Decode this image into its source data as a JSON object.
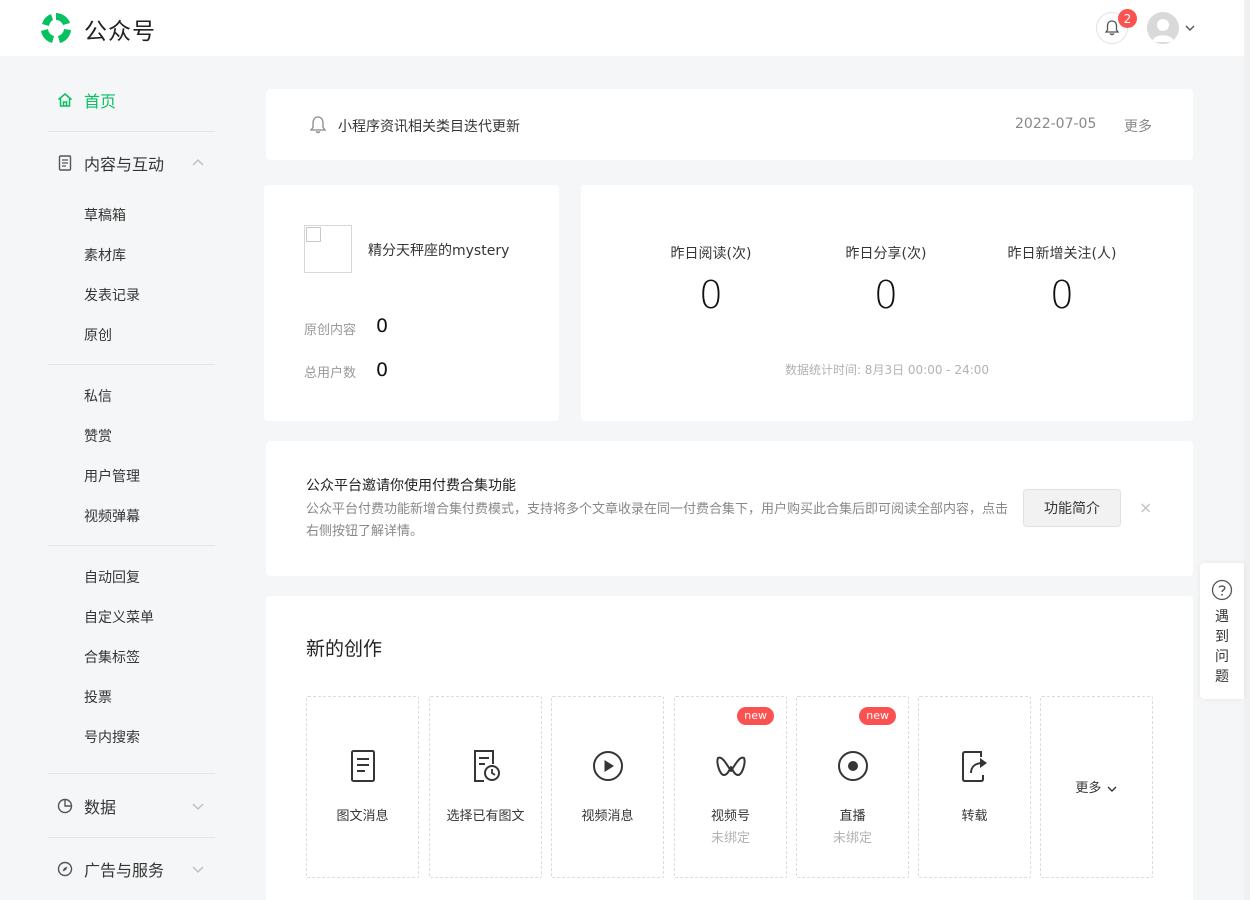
{
  "header": {
    "brand": "公众号",
    "notification_count": "2",
    "colors": {
      "brand": "#07c160",
      "badge": "#fa5151"
    }
  },
  "sidebar": {
    "home": "首页",
    "content_section": "内容与互动",
    "content_items": [
      "草稿箱",
      "素材库",
      "发表记录",
      "原创"
    ],
    "interaction_items": [
      "私信",
      "赞赏",
      "用户管理",
      "视频弹幕"
    ],
    "function_items": [
      "自动回复",
      "自定义菜单",
      "合集标签",
      "投票",
      "号内搜索"
    ],
    "data_section": "数据",
    "ads_section": "广告与服务"
  },
  "notice": {
    "text": "小程序资讯相关类目迭代更新",
    "date": "2022-07-05",
    "more": "更多"
  },
  "account": {
    "name": "精分天秤座的mystery",
    "original_label": "原创内容",
    "original_value": "0",
    "users_label": "总用户数",
    "users_value": "0"
  },
  "stats": {
    "items": [
      {
        "label": "昨日阅读(次)",
        "value": "0"
      },
      {
        "label": "昨日分享(次)",
        "value": "0"
      },
      {
        "label": "昨日新增关注(人)",
        "value": "0"
      }
    ],
    "note": "数据统计时间: 8月3日 00:00 - 24:00"
  },
  "promo": {
    "title": "公众平台邀请你使用付费合集功能",
    "description": "公众平台付费功能新增合集付费模式，支持将多个文章收录在同一付费合集下，用户购买此合集后即可阅读全部内容，点击右侧按钮了解详情。",
    "button": "功能简介",
    "close": "×"
  },
  "create": {
    "title": "新的创作",
    "tiles": [
      {
        "label": "图文消息",
        "icon": "article-icon"
      },
      {
        "label": "选择已有图文",
        "icon": "existing-article-icon"
      },
      {
        "label": "视频消息",
        "icon": "video-play-icon"
      },
      {
        "label": "视频号",
        "sub": "未绑定",
        "new": "new",
        "icon": "channels-icon"
      },
      {
        "label": "直播",
        "sub": "未绑定",
        "new": "new",
        "icon": "live-icon"
      },
      {
        "label": "转载",
        "icon": "repost-icon"
      }
    ],
    "more": "更多"
  },
  "help": {
    "text": "遇到问题"
  }
}
